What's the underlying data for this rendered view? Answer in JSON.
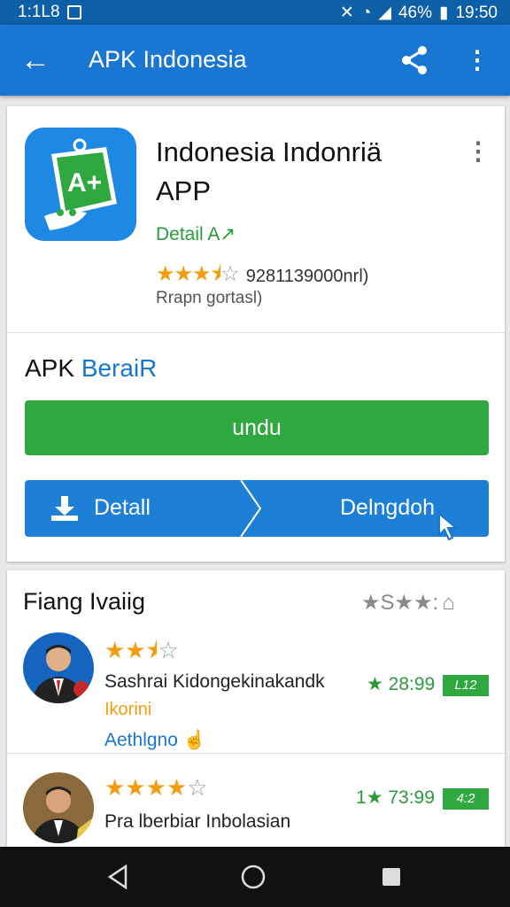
{
  "status_bar": {
    "left_text": "1:1L8",
    "battery": "46%",
    "time": "19:50"
  },
  "app_bar": {
    "title": "APK Indonesia",
    "back_icon": "arrow-back-icon",
    "share_icon": "share-icon",
    "more_icon": "more-vert-icon"
  },
  "app_card": {
    "name": "Indonesia Indonriä APP",
    "developer": "Detail A↗",
    "rating_stars": 3.5,
    "rating_count": "9281139000nrl)",
    "subtitle": "Rrapn gortasl)",
    "section_prefix": "APK ",
    "section_highlight": "BeraiR",
    "download_label": "undu",
    "detail_label": "Detall",
    "download2_label": "Delngdoh",
    "colors": {
      "blue": "#1976d2",
      "green": "#2ea83f",
      "star": "#f39c12"
    }
  },
  "reviews": {
    "title": "Fiang Ivaiig",
    "header_stars": "★S★★:",
    "items": [
      {
        "stars": 2.5,
        "name": "Sashrai Kidongekinakandk",
        "tag": "Ikorini",
        "link": "Aethlgno",
        "score": "★ 28:99",
        "badge": "L12"
      },
      {
        "stars": 4,
        "name": "Pra lberbiar Inbolasian",
        "score": "1★ 73:99",
        "badge": "4:2"
      }
    ]
  },
  "nav_bar": {
    "back": "nav-back-icon",
    "home": "nav-home-icon",
    "recents": "nav-recents-icon"
  }
}
